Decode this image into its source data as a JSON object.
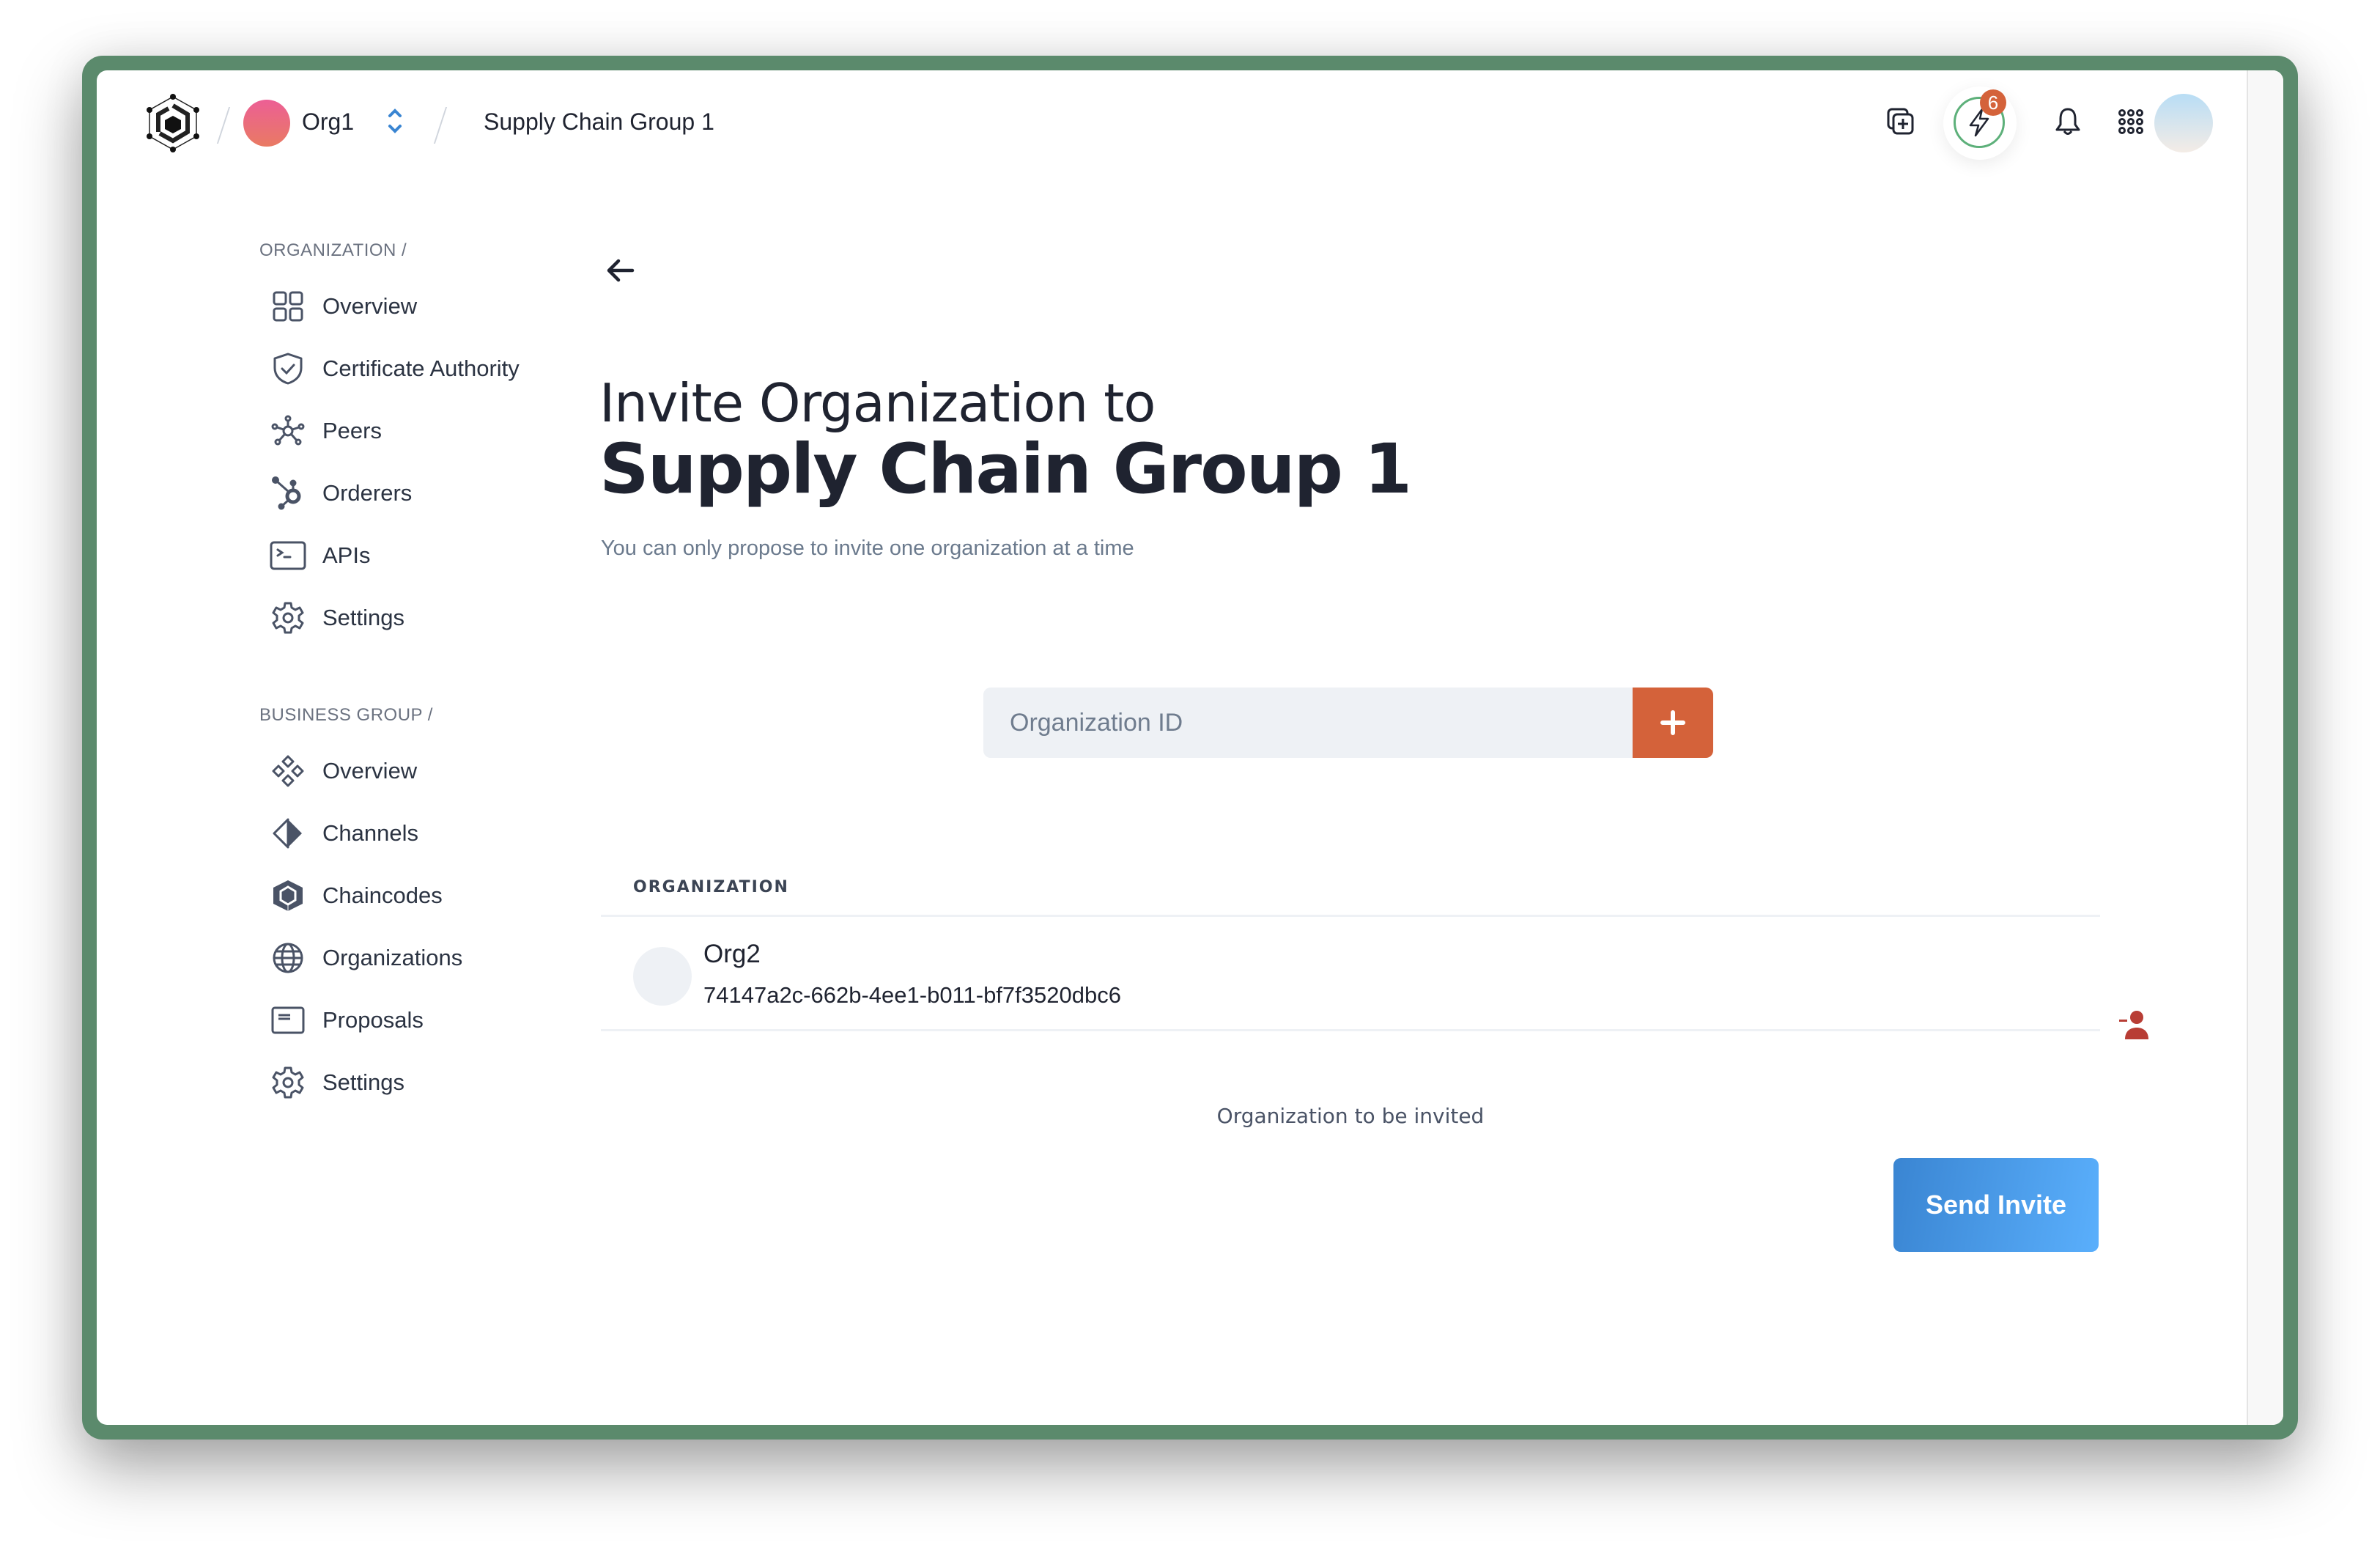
{
  "header": {
    "org_name": "Org1",
    "breadcrumb": "Supply Chain Group 1",
    "notification_badge": "6",
    "icons": [
      "add-window-icon",
      "bolt-icon",
      "bell-icon",
      "apps-grid-icon"
    ]
  },
  "sidebar": {
    "organization_heading": "ORGANIZATION /",
    "organization_items": [
      {
        "label": "Overview",
        "icon": "grid-icon"
      },
      {
        "label": "Certificate Authority",
        "icon": "shield-check-icon"
      },
      {
        "label": "Peers",
        "icon": "network-icon"
      },
      {
        "label": "Orderers",
        "icon": "hub-icon"
      },
      {
        "label": "APIs",
        "icon": "terminal-icon"
      },
      {
        "label": "Settings",
        "icon": "gear-icon"
      }
    ],
    "business_heading": "BUSINESS GROUP /",
    "business_items": [
      {
        "label": "Overview",
        "icon": "diamonds-icon"
      },
      {
        "label": "Channels",
        "icon": "half-diamond-icon"
      },
      {
        "label": "Chaincodes",
        "icon": "hexagon-cube-icon"
      },
      {
        "label": "Organizations",
        "icon": "globe-icon"
      },
      {
        "label": "Proposals",
        "icon": "card-icon"
      },
      {
        "label": "Settings",
        "icon": "gear-icon"
      }
    ]
  },
  "main": {
    "title_line1": "Invite Organization to",
    "title_line2": "Supply Chain Group 1",
    "subtitle": "You can only propose to invite one organization at a time",
    "input": {
      "placeholder": "Organization ID",
      "value": ""
    },
    "table": {
      "header": "ORGANIZATION",
      "rows": [
        {
          "name": "Org2",
          "id": "74147a2c-662b-4ee1-b011-bf7f3520dbc6"
        }
      ]
    },
    "caption": "Organization to be invited",
    "send_label": "Send Invite"
  },
  "colors": {
    "frame": "#5b8a6c",
    "accent_orange": "#d4623a",
    "accent_blue": "#3a85d2",
    "remove_red": "#b83d35"
  }
}
